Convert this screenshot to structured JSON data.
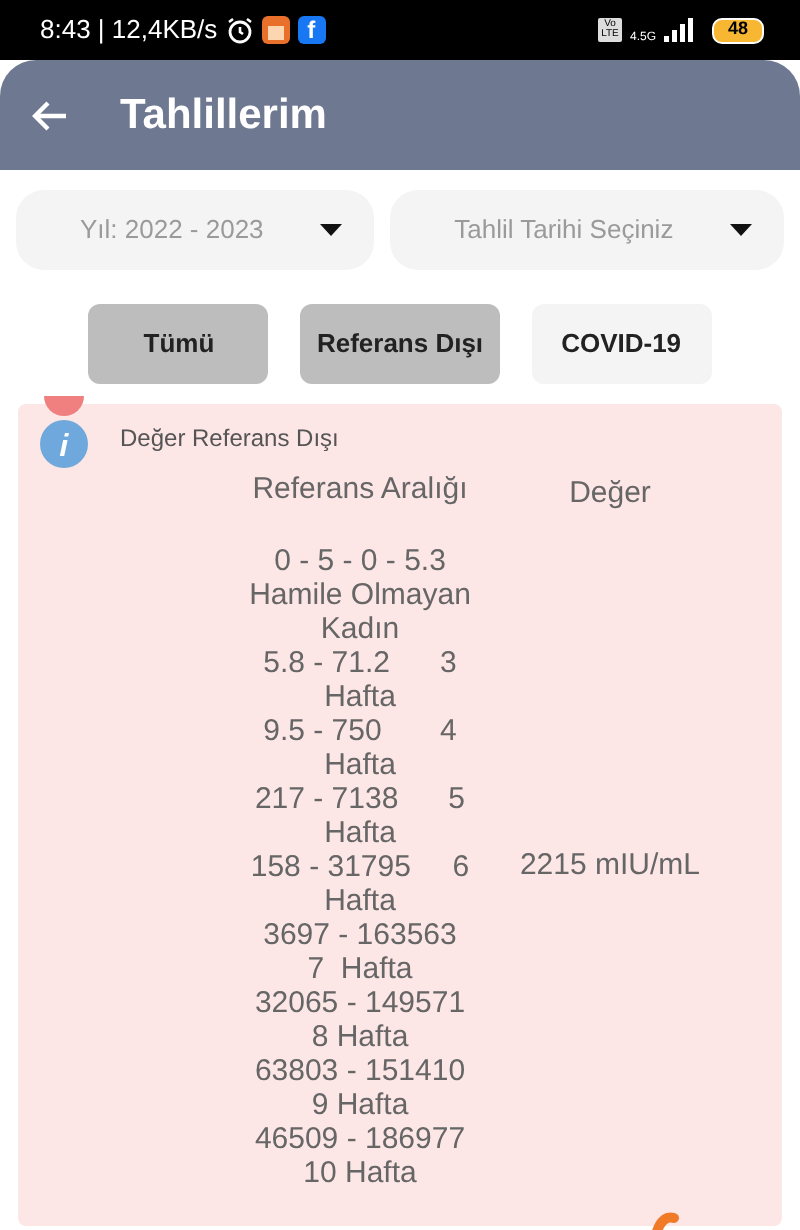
{
  "status_bar": {
    "time": "8:43 | 12,4KB/s",
    "app_letter": "f",
    "volte": "Vo LTE",
    "network": "4.5G",
    "battery": "48"
  },
  "header": {
    "title": "Tahlillerim"
  },
  "filters": [
    {
      "placeholder": "Yıl: 2022 - 2023"
    },
    {
      "placeholder": "Tahlil Tarihi Seçiniz"
    }
  ],
  "segments": [
    {
      "label": "Tümü",
      "selected": true
    },
    {
      "label": "Referans Dışı",
      "selected": true
    },
    {
      "label": "COVID-19",
      "selected": false
    }
  ],
  "result": {
    "status": "Değer Referans Dışı",
    "out_of_range": true,
    "columns": [
      "Referans Aralığı",
      "Değer"
    ],
    "reference_lines": [
      "0 - 5 - 0 - 5.3",
      "Hamile Olmayan",
      "Kadın",
      "5.8 - 71.2      3",
      "Hafta",
      "9.5 - 750       4",
      "Hafta",
      "217 - 7138      5",
      "Hafta",
      "158 - 31795     6",
      "Hafta",
      "3697 - 163563",
      "7  Hafta",
      "32065 - 149571",
      "8 Hafta",
      "63803 - 151410",
      "9 Hafta",
      "46509 - 186977",
      "10 Hafta"
    ],
    "value": "2215 mIU/mL"
  }
}
